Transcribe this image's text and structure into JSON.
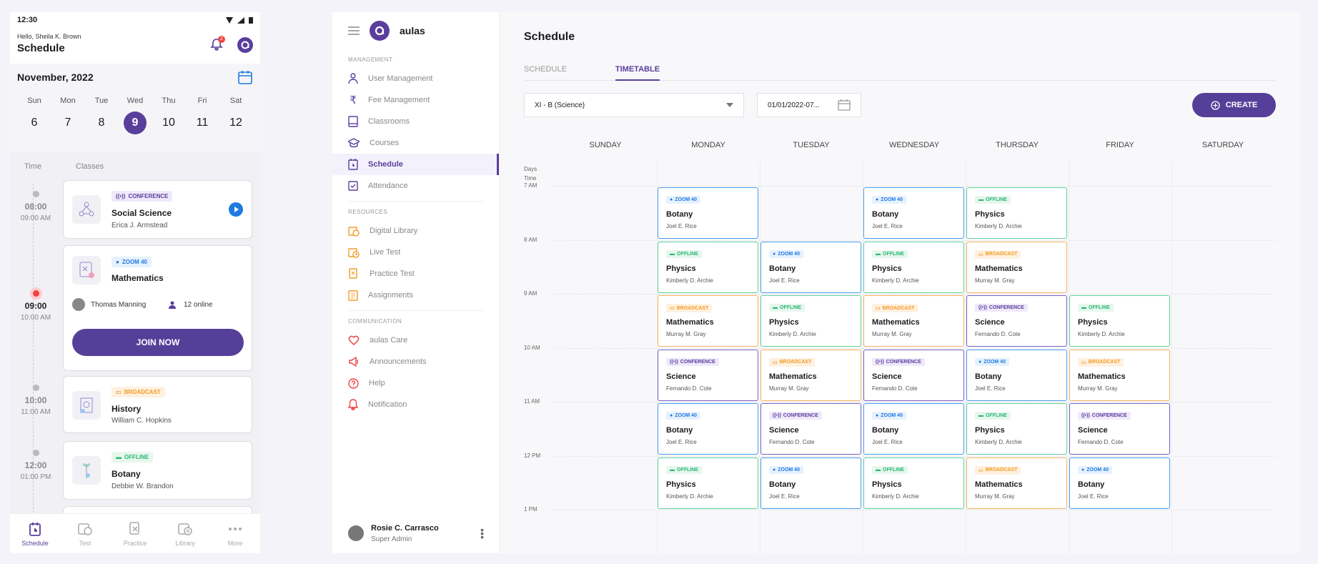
{
  "colors": {
    "accent": "#563f98",
    "zoom": "#1f7ae0",
    "broadcast": "#f39a23",
    "offline": "#2bb673",
    "conference": "#5a3e9c",
    "live": "#e44444"
  },
  "mobile": {
    "status_time": "12:30",
    "greeting": "Hello, Sheila K. Brown",
    "title": "Schedule",
    "notification_count": "2",
    "month": "November, 2022",
    "weekdays": [
      {
        "name": "Sun",
        "date": "6"
      },
      {
        "name": "Mon",
        "date": "7"
      },
      {
        "name": "Tue",
        "date": "8"
      },
      {
        "name": "Wed",
        "date": "9"
      },
      {
        "name": "Thu",
        "date": "10"
      },
      {
        "name": "Fri",
        "date": "11"
      },
      {
        "name": "Sat",
        "date": "12"
      }
    ],
    "col_time": "Time",
    "col_classes": "Classes",
    "slots": [
      {
        "time": "08:00",
        "sub": "09:00 AM"
      },
      {
        "time": "09:00",
        "sub": "10:00 AM"
      },
      {
        "time": "10:00",
        "sub": "11:00 AM"
      },
      {
        "time": "12:00",
        "sub": "01:00 PM"
      }
    ],
    "classes": [
      {
        "tag": "CONFERENCE",
        "name": "Social Science",
        "teacher": "Erica J. Armstead"
      },
      {
        "tag": "ZOOM 40",
        "name": "Mathematics",
        "teacher": "Thomas Manning",
        "online": "12 online",
        "join": "JOIN NOW"
      },
      {
        "tag": "BROADCAST",
        "name": "History",
        "teacher": "William C. Hopkins"
      },
      {
        "tag": "OFFLINE",
        "name": "Botany",
        "teacher": "Debbie W. Brandon"
      }
    ],
    "tabs": [
      {
        "label": "Schedule",
        "icon": "schedule-icon"
      },
      {
        "label": "Test",
        "icon": "test-icon"
      },
      {
        "label": "Practice",
        "icon": "practice-icon"
      },
      {
        "label": "Library",
        "icon": "library-icon"
      },
      {
        "label": "More",
        "icon": "more-icon"
      }
    ]
  },
  "sidebar": {
    "brand": "aulas",
    "management_label": "MANAGEMENT",
    "management": [
      "User Management",
      "Fee Management",
      "Classrooms",
      "Courses",
      "Schedule",
      "Attendance"
    ],
    "resources_label": "RESOURCES",
    "resources": [
      "Digital Library",
      "Live Test",
      "Practice Test",
      "Assignments"
    ],
    "communication_label": "COMMUNICATION",
    "communication": [
      "aulas Care",
      "Announcements",
      "Help",
      "Notification"
    ],
    "user_name": "Rosie C. Carrasco",
    "user_role": "Super Admin"
  },
  "main": {
    "title": "Schedule",
    "tabs": [
      "SCHEDULE",
      "TIMETABLE"
    ],
    "class_select": "XI - B (Science)",
    "date_range": "01/01/2022-07...",
    "create_label": "CREATE",
    "days_label": "Days",
    "time_label": "Time",
    "days": [
      "SUNDAY",
      "MONDAY",
      "TUESDAY",
      "WEDNESDAY",
      "THURSDAY",
      "FRIDAY",
      "SATURDAY"
    ],
    "times": [
      "7 AM",
      "8 AM",
      "9 AM",
      "10 AM",
      "11 AM",
      "12 PM",
      "1 PM"
    ],
    "events": [
      {
        "day": 1,
        "slot": 0,
        "tag": "ZOOM 40",
        "kind": "zoom",
        "title": "Botany",
        "teacher": "Joel E. Rice"
      },
      {
        "day": 3,
        "slot": 0,
        "tag": "ZOOM 40",
        "kind": "zoom",
        "title": "Botany",
        "teacher": "Joel E. Rice"
      },
      {
        "day": 4,
        "slot": 0,
        "tag": "OFFLINE",
        "kind": "off",
        "title": "Physics",
        "teacher": "Kimberly D. Archie"
      },
      {
        "day": 1,
        "slot": 1,
        "tag": "OFFLINE",
        "kind": "off",
        "title": "Physics",
        "teacher": "Kimberly D. Archie"
      },
      {
        "day": 2,
        "slot": 1,
        "tag": "ZOOM 40",
        "kind": "zoom",
        "title": "Botany",
        "teacher": "Joel E. Rice"
      },
      {
        "day": 3,
        "slot": 1,
        "tag": "OFFLINE",
        "kind": "off",
        "title": "Physics",
        "teacher": "Kimberly D. Archie"
      },
      {
        "day": 4,
        "slot": 1,
        "tag": "BROADCAST",
        "kind": "broad",
        "title": "Mathematics",
        "teacher": "Murray M. Gray"
      },
      {
        "day": 1,
        "slot": 2,
        "tag": "BROADCAST",
        "kind": "broad",
        "title": "Mathematics",
        "teacher": "Murray M. Gray"
      },
      {
        "day": 2,
        "slot": 2,
        "tag": "OFFLINE",
        "kind": "off",
        "title": "Physics",
        "teacher": "Kimberly D. Archie"
      },
      {
        "day": 3,
        "slot": 2,
        "tag": "BROADCAST",
        "kind": "broad",
        "title": "Mathematics",
        "teacher": "Murray M. Gray"
      },
      {
        "day": 4,
        "slot": 2,
        "tag": "CONFERENCE",
        "kind": "conf",
        "title": "Science",
        "teacher": "Fernando D. Cote"
      },
      {
        "day": 5,
        "slot": 2,
        "tag": "OFFLINE",
        "kind": "off",
        "title": "Physics",
        "teacher": "Kimberly D. Archie"
      },
      {
        "day": 1,
        "slot": 3,
        "tag": "CONFERENCE",
        "kind": "conf",
        "title": "Science",
        "teacher": "Fernando D. Cote"
      },
      {
        "day": 2,
        "slot": 3,
        "tag": "BROADCAST",
        "kind": "broad",
        "title": "Mathematics",
        "teacher": "Murray M. Gray"
      },
      {
        "day": 3,
        "slot": 3,
        "tag": "CONFERENCE",
        "kind": "conf",
        "title": "Science",
        "teacher": "Fernando D. Cote"
      },
      {
        "day": 4,
        "slot": 3,
        "tag": "ZOOM 40",
        "kind": "zoom",
        "title": "Botany",
        "teacher": "Joel E. Rice"
      },
      {
        "day": 5,
        "slot": 3,
        "tag": "BROADCAST",
        "kind": "broad",
        "title": "Mathematics",
        "teacher": "Murray M. Gray"
      },
      {
        "day": 1,
        "slot": 4,
        "tag": "ZOOM 40",
        "kind": "zoom",
        "title": "Botany",
        "teacher": "Joel E. Rice"
      },
      {
        "day": 2,
        "slot": 4,
        "tag": "CONFERENCE",
        "kind": "conf",
        "title": "Science",
        "teacher": "Fernando D. Cote"
      },
      {
        "day": 3,
        "slot": 4,
        "tag": "ZOOM 40",
        "kind": "zoom",
        "title": "Botany",
        "teacher": "Joel E. Rice"
      },
      {
        "day": 4,
        "slot": 4,
        "tag": "OFFLINE",
        "kind": "off",
        "title": "Physics",
        "teacher": "Kimberly D. Archie"
      },
      {
        "day": 5,
        "slot": 4,
        "tag": "CONFERENCE",
        "kind": "conf",
        "title": "Science",
        "teacher": "Fernando D. Cote"
      },
      {
        "day": 1,
        "slot": 5,
        "tag": "OFFLINE",
        "kind": "off",
        "title": "Physics",
        "teacher": "Kimberly D. Archie"
      },
      {
        "day": 2,
        "slot": 5,
        "tag": "ZOOM 40",
        "kind": "zoom",
        "title": "Botany",
        "teacher": "Joel E. Rice"
      },
      {
        "day": 3,
        "slot": 5,
        "tag": "OFFLINE",
        "kind": "off",
        "title": "Physics",
        "teacher": "Kimberly D. Archie"
      },
      {
        "day": 4,
        "slot": 5,
        "tag": "BROADCAST",
        "kind": "broad",
        "title": "Mathematics",
        "teacher": "Murray M. Gray"
      },
      {
        "day": 5,
        "slot": 5,
        "tag": "ZOOM 40",
        "kind": "zoom",
        "title": "Botany",
        "teacher": "Joel E. Rice"
      }
    ]
  }
}
